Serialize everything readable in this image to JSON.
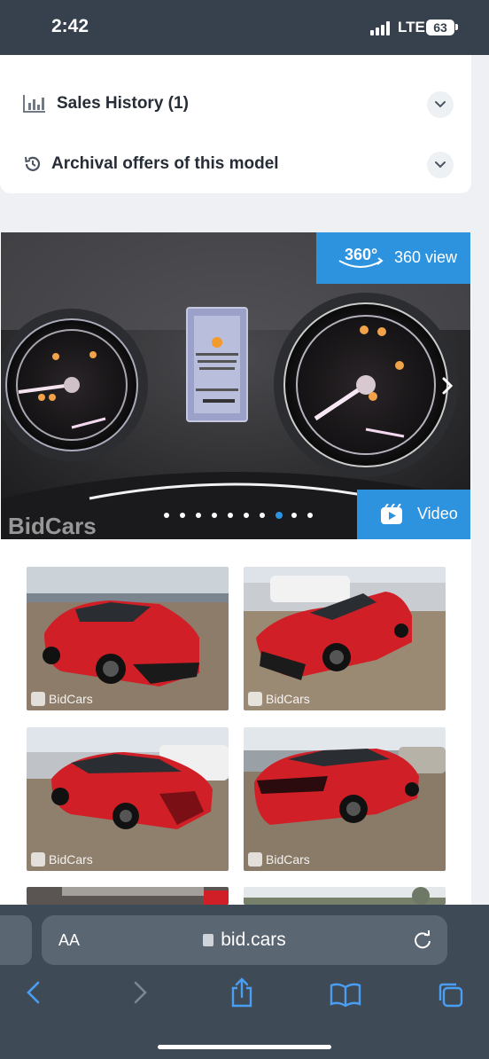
{
  "status_bar": {
    "time": "2:42",
    "network": "LTE",
    "battery": "63"
  },
  "info_card": {
    "sales_history": "Sales History (1)",
    "archival_offers": "Archival offers of this model"
  },
  "gallery": {
    "btn_360": "360 view",
    "btn_360_badge": "360°",
    "btn_video": "Video",
    "watermark": "BidCars",
    "dot_count": 10,
    "active_dot": 7,
    "photos": [
      {
        "watermark": "BidCars"
      },
      {
        "watermark": "BidCars"
      },
      {
        "watermark": "BidCars"
      },
      {
        "watermark": "BidCars"
      }
    ]
  },
  "browser": {
    "aa_label": "AA",
    "url": "bid.cars"
  },
  "colors": {
    "accent": "#2d93df",
    "status_bar": "#36414d",
    "car_red": "#d11f27"
  }
}
